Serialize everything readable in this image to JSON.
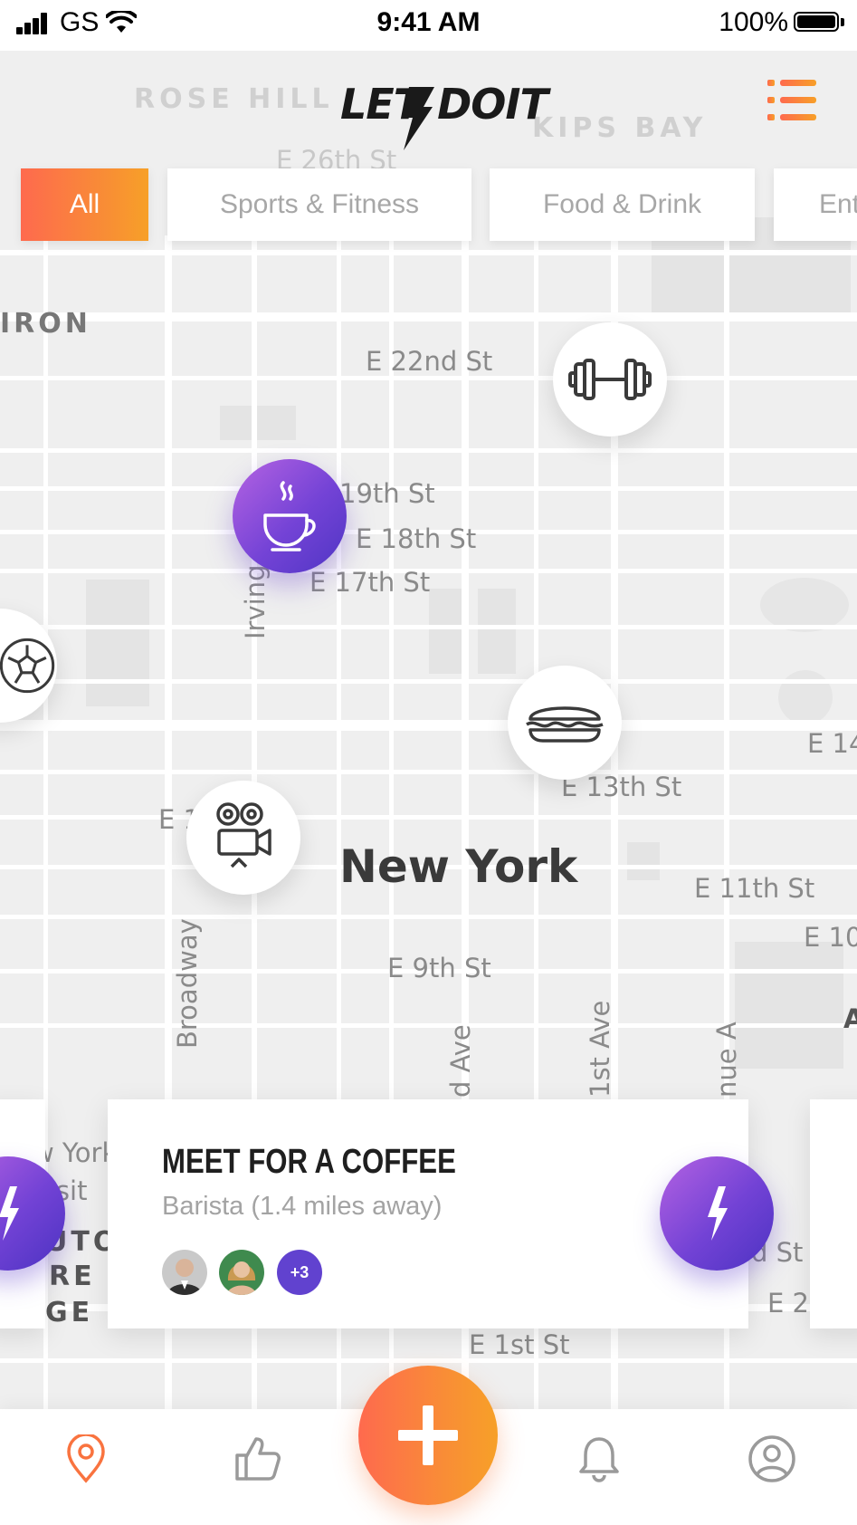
{
  "status_bar": {
    "carrier": "GS",
    "time": "9:41 AM",
    "battery_percent": "100%"
  },
  "header": {
    "logo_text": "LET'S DO IT",
    "logo_left": "LET",
    "logo_right": "DOIT",
    "menu_icon": "list-menu-icon"
  },
  "filters": [
    {
      "label": "All",
      "active": true
    },
    {
      "label": "Sports & Fitness",
      "active": false
    },
    {
      "label": "Food & Drink",
      "active": false
    },
    {
      "label": "Ent",
      "active": false
    }
  ],
  "map": {
    "city_label": "New York",
    "labels": {
      "rose_hill": "ROSE HILL",
      "kips_bay": "KIPS BAY",
      "e26": "E 26th St",
      "iron": "IRON",
      "e22": "E 22nd St",
      "e19": "19th St",
      "e18": "E 18th St",
      "e17": "E 17th St",
      "irving": "Irving",
      "e14": "E 14",
      "e13": "E 13th St",
      "e1x": "E 1",
      "e11": "E 11th St",
      "e10": "E 10",
      "e9": "E 9th St",
      "broadway": "Broadway",
      "d_ave": "d Ave",
      "first_ave": "1st Ave",
      "nue_a": "nue A",
      "a_edge": "A",
      "e1st": "E 1st St",
      "york": "w York",
      "rsit": "rsit",
      "uto": "UTO",
      "re": "RE",
      "ge": "GE",
      "d_st": "d St",
      "e2": "E 2"
    },
    "markers": [
      {
        "name": "fitness",
        "icon": "dumbbell-icon"
      },
      {
        "name": "coffee",
        "icon": "coffee-cup-icon",
        "selected": true
      },
      {
        "name": "soccer",
        "icon": "soccer-ball-icon"
      },
      {
        "name": "food",
        "icon": "sandwich-icon"
      },
      {
        "name": "movie",
        "icon": "movie-camera-icon"
      }
    ]
  },
  "event_card": {
    "title": "MEET FOR A COFFEE",
    "subtitle": "Barista (1.4 miles away)",
    "extra_attendees": "+3",
    "action_icon": "lightning-bolt-icon"
  },
  "bottom_nav": {
    "items": [
      {
        "name": "map",
        "icon": "map-pin-icon",
        "active": true
      },
      {
        "name": "likes",
        "icon": "thumbs-up-icon"
      },
      {
        "name": "create",
        "icon": "plus-icon"
      },
      {
        "name": "notifications",
        "icon": "bell-icon"
      },
      {
        "name": "profile",
        "icon": "user-profile-icon"
      }
    ]
  },
  "colors": {
    "accent_orange": "#fe6a4e",
    "accent_orange_end": "#f7a028",
    "accent_purple": "#7443d6",
    "text_dark": "#1f1f1f",
    "text_muted": "#a3a3a3"
  }
}
